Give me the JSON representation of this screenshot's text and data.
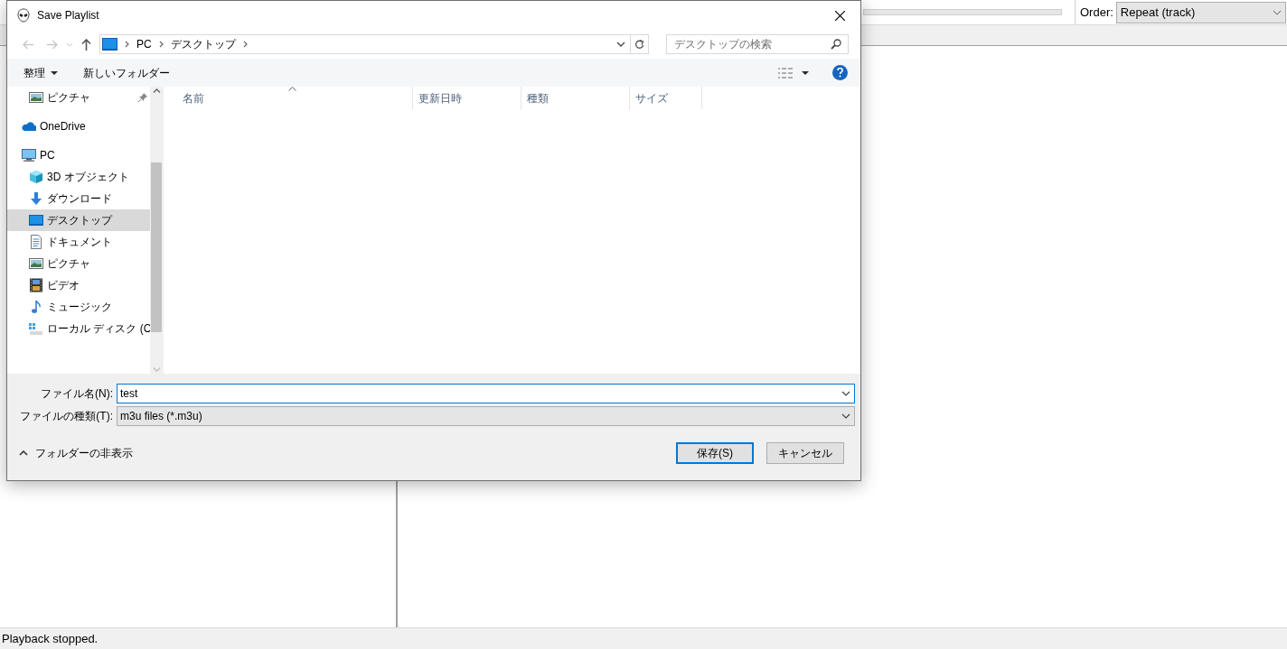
{
  "app": {
    "order_label": "Order:",
    "order_value": "Repeat (track)",
    "status": "Playback stopped."
  },
  "dialog": {
    "title": "Save Playlist",
    "breadcrumb": [
      "PC",
      "デスクトップ"
    ],
    "search_placeholder": "デスクトップの検索",
    "organize_button": "整理",
    "new_folder_button": "新しいフォルダー",
    "quick_access": [
      {
        "label": "ピクチャ",
        "kind": "pictures",
        "pinned": true,
        "selected": false
      }
    ],
    "nav_items": [
      {
        "label": "OneDrive",
        "kind": "onedrive",
        "selected": false
      },
      {
        "label": "PC",
        "kind": "pc",
        "selected": false,
        "children": [
          {
            "label": "3D オブジェクト",
            "kind": "objects3d",
            "selected": false
          },
          {
            "label": "ダウンロード",
            "kind": "downloads",
            "selected": false
          },
          {
            "label": "デスクトップ",
            "kind": "desktop",
            "selected": true
          },
          {
            "label": "ドキュメント",
            "kind": "documents",
            "selected": false
          },
          {
            "label": "ピクチャ",
            "kind": "pictures",
            "selected": false
          },
          {
            "label": "ビデオ",
            "kind": "video",
            "selected": false
          },
          {
            "label": "ミュージック",
            "kind": "music",
            "selected": false
          },
          {
            "label": "ローカル ディスク (C",
            "kind": "disk",
            "selected": false
          }
        ]
      }
    ],
    "columns": [
      {
        "label": "名前",
        "sorted": true
      },
      {
        "label": "更新日時",
        "sorted": false
      },
      {
        "label": "種類",
        "sorted": false
      },
      {
        "label": "サイズ",
        "sorted": false
      }
    ],
    "file_name_label": "ファイル名(N):",
    "file_name": "test",
    "file_type_label": "ファイルの種類(T):",
    "file_type": "m3u files (*.m3u)",
    "hide_folders": "フォルダーの非表示",
    "save_button": "保存(S)",
    "cancel_button": "キャンセル"
  }
}
